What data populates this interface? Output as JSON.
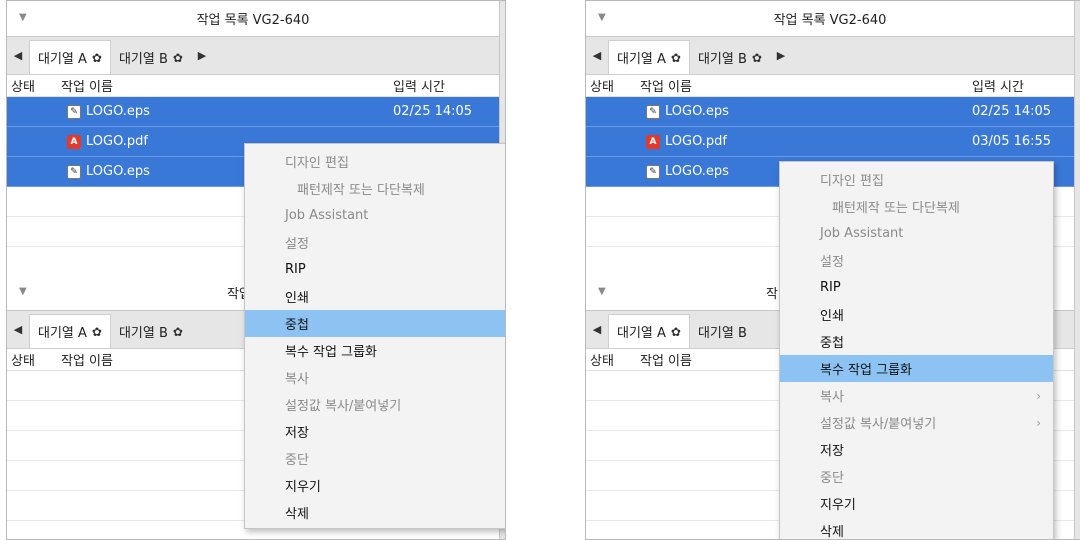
{
  "top_section": {
    "title": "작업 목록 VG2-640",
    "tabs": [
      {
        "label": "대기열 A",
        "active": true
      },
      {
        "label": "대기열 B",
        "active": false
      }
    ],
    "columns": {
      "status": "상태",
      "name": "작업 이름",
      "time": "입력 시간"
    },
    "rows": [
      {
        "file": "LOGO.eps",
        "type": "eps",
        "time": "02/25 14:05"
      },
      {
        "file": "LOGO.pdf",
        "type": "pdf",
        "time": "03/05 16:55"
      },
      {
        "file": "LOGO.eps",
        "type": "eps",
        "time": ""
      }
    ]
  },
  "bottom_section": {
    "title": "작업 목록",
    "title_right_partial": "작",
    "tabs": [
      {
        "label": "대기열 A"
      },
      {
        "label": "대기열 B"
      }
    ],
    "columns": {
      "status": "상태",
      "name": "작업 이름"
    }
  },
  "menu_items": [
    {
      "label": "디자인 편집",
      "disabled": true
    },
    {
      "label": "패턴제작 또는 다단복제",
      "disabled": true,
      "indent": true
    },
    {
      "label": "Job Assistant",
      "disabled": true
    },
    {
      "label": "설정",
      "disabled": true
    },
    {
      "label": "RIP",
      "disabled": false
    },
    {
      "label": "인쇄",
      "disabled": false
    },
    {
      "label": "중첩",
      "disabled": false
    },
    {
      "label": "복수 작업 그룹화",
      "disabled": false
    },
    {
      "label": "복사",
      "disabled": true,
      "submenu": true
    },
    {
      "label": "설정값 복사/붙여넣기",
      "disabled": true,
      "submenu": true
    },
    {
      "label": "저장",
      "disabled": false
    },
    {
      "label": "중단",
      "disabled": true
    },
    {
      "label": "지우기",
      "disabled": false
    },
    {
      "label": "삭제",
      "disabled": false
    }
  ],
  "glyphs": {
    "collapse": "▼",
    "left": "◀",
    "right": "▶",
    "gear": "✿",
    "submenu": "›",
    "eps": "✎",
    "pdf": "A"
  },
  "colors": {
    "selection": "#3a78d8",
    "menu_highlight": "#8cc3f2",
    "pdf_icon": "#e23b2e"
  },
  "left_highlight": "중첩",
  "right_highlight": "복수 작업 그룹화"
}
